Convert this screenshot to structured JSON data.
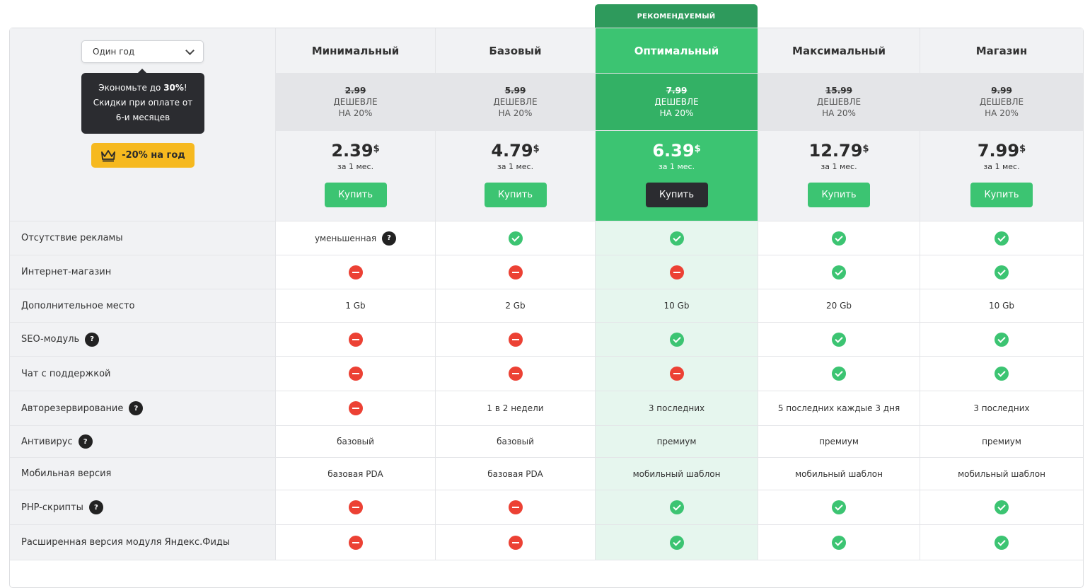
{
  "recommended_label": "РЕКОМЕНДУЕМЫЙ",
  "period": {
    "selected": "Один год",
    "tooltip_line1_pre": "Экономьте до ",
    "tooltip_line1_bold": "30%",
    "tooltip_line1_post": "!",
    "tooltip_line2": "Скидки при оплате от",
    "tooltip_line3": "6-и месяцев",
    "discount_badge": "-20% на год"
  },
  "plans": [
    {
      "name": "Минимальный",
      "old_price": "2.99",
      "discount_line1": "ДЕШЕВЛЕ",
      "discount_line2": "НА 20%",
      "price": "2.39",
      "currency": "$",
      "period": "за 1 мес.",
      "buy_label": "Купить"
    },
    {
      "name": "Базовый",
      "old_price": "5.99",
      "discount_line1": "ДЕШЕВЛЕ",
      "discount_line2": "НА 20%",
      "price": "4.79",
      "currency": "$",
      "period": "за 1 мес.",
      "buy_label": "Купить"
    },
    {
      "name": "Оптимальный",
      "old_price": "7.99",
      "discount_line1": "ДЕШЕВЛЕ",
      "discount_line2": "НА 20%",
      "price": "6.39",
      "currency": "$",
      "period": "за 1 мес.",
      "buy_label": "Купить"
    },
    {
      "name": "Максимальный",
      "old_price": "15.99",
      "discount_line1": "ДЕШЕВЛЕ",
      "discount_line2": "НА 20%",
      "price": "12.79",
      "currency": "$",
      "period": "за 1 мес.",
      "buy_label": "Купить"
    },
    {
      "name": "Магазин",
      "old_price": "9.99",
      "discount_line1": "ДЕШЕВЛЕ",
      "discount_line2": "НА 20%",
      "price": "7.99",
      "currency": "$",
      "period": "за 1 мес.",
      "buy_label": "Купить"
    }
  ],
  "features": [
    {
      "label": "Отсутствие рекламы",
      "help": false,
      "values": [
        "уменьшенная",
        "yes",
        "yes",
        "yes",
        "yes"
      ],
      "value0_help": true
    },
    {
      "label": "Интернет-магазин",
      "help": false,
      "values": [
        "no",
        "no",
        "no",
        "yes",
        "yes"
      ]
    },
    {
      "label": "Дополнительное место",
      "help": false,
      "values": [
        "1 Gb",
        "2 Gb",
        "10 Gb",
        "20 Gb",
        "10 Gb"
      ]
    },
    {
      "label": "SEO-модуль",
      "help": true,
      "values": [
        "no",
        "no",
        "yes",
        "yes",
        "yes"
      ]
    },
    {
      "label": "Чат с поддержкой",
      "help": false,
      "values": [
        "no",
        "no",
        "no",
        "yes",
        "yes"
      ]
    },
    {
      "label": "Авторезервирование",
      "help": true,
      "values": [
        "no",
        "1 в 2 недели",
        "3 последних",
        "5 последних каждые 3 дня",
        "3 последних"
      ]
    },
    {
      "label": "Антивирус",
      "help": true,
      "values": [
        "базовый",
        "базовый",
        "премиум",
        "премиум",
        "премиум"
      ]
    },
    {
      "label": "Мобильная версия",
      "help": false,
      "values": [
        "базовая PDA",
        "базовая PDA",
        "мобильный шаблон",
        "мобильный шаблон",
        "мобильный шаблон"
      ]
    },
    {
      "label": "PHP-скрипты",
      "help": true,
      "values": [
        "no",
        "no",
        "yes",
        "yes",
        "yes"
      ]
    },
    {
      "label": "Расширенная версия модуля Яндекс.Фиды",
      "help": false,
      "values": [
        "no",
        "no",
        "yes",
        "yes",
        "yes"
      ]
    }
  ],
  "help_glyph": "?",
  "icons": {
    "yes": "check-circle-icon",
    "no": "minus-circle-icon",
    "help": "question-icon",
    "crown": "crown-icon",
    "chevron": "chevron-down-icon"
  },
  "colors": {
    "green": "#3cc472",
    "green_dark": "#2e9a5c",
    "red": "#ec4134",
    "dark": "#2b2c30",
    "yellow": "#f6b91f"
  }
}
